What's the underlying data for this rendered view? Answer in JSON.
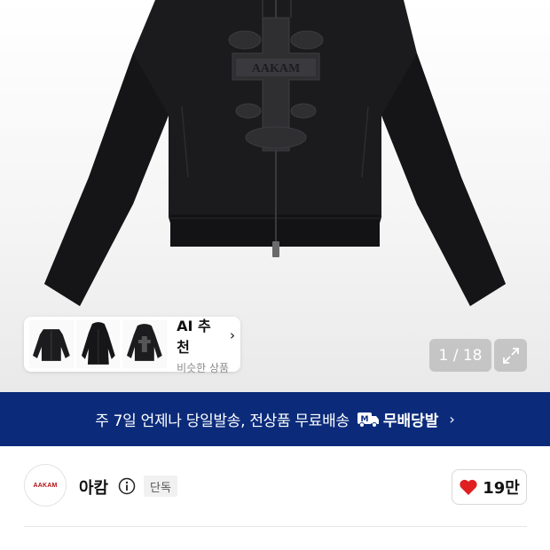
{
  "gallery": {
    "ai_card": {
      "title": "AI 추천",
      "subtitle": "비슷한 상품"
    },
    "counter": "1 / 18",
    "product_print_text": "AAKAM"
  },
  "banner": {
    "message": "주 7일 언제나 당일발송, 전상품 무료배송",
    "badge_label": "무배당발",
    "badge_icon": "truck-m-icon",
    "background": "#0b2b7a"
  },
  "brand": {
    "logo_text": "AAKAM",
    "name": "아캄",
    "tag": "단독"
  },
  "like": {
    "count": "19만",
    "heart_color": "#e02020"
  }
}
